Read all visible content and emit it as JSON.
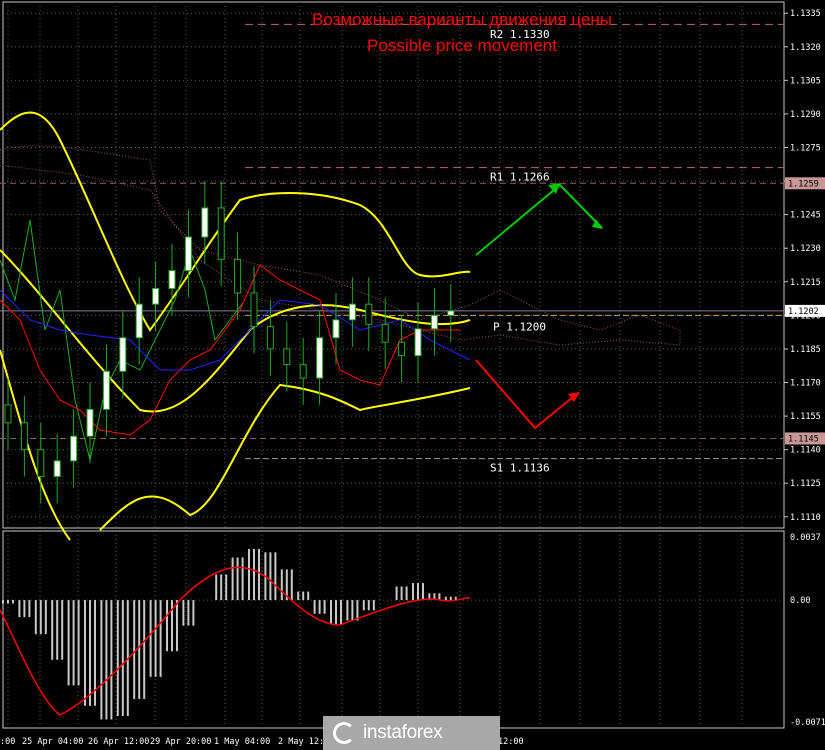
{
  "annotations": {
    "title_ru": "Возможные варианты движения цены",
    "title_en": "Possible price movement",
    "r2": "R2 1.1330",
    "r1": "R1 1.1266",
    "pivot": "P 1.1200",
    "s1": "S1 1.1136"
  },
  "price_axis": {
    "ticks": [
      "1.1335",
      "1.1320",
      "1.1305",
      "1.1290",
      "1.1275",
      "1.1260",
      "1.1245",
      "1.1230",
      "1.1215",
      "1.1200",
      "1.1185",
      "1.1170",
      "1.1155",
      "1.1140",
      "1.1125",
      "1.1110"
    ],
    "tag_upper": "1.1259",
    "tag_current": "1.1202",
    "tag_lower": "1.1145"
  },
  "osc_axis": {
    "ticks": [
      "0.0037",
      "0.00",
      "-0.00715"
    ]
  },
  "time_axis": {
    "labels": [
      ":00",
      "25 Apr 04:00",
      "26 Apr 12:00",
      "29 Apr 20:00",
      "1 May 04:00",
      "2 May 12:00",
      "12:00"
    ]
  },
  "watermark": {
    "brand": "instaforex"
  },
  "colors": {
    "background": "#000000",
    "grid": "#5a5a5a",
    "candle_bull": "#ffffff",
    "bollinger": "#ffff00",
    "fast_line": "#22aa22",
    "red_line": "#ff0000",
    "blue_line": "#2222ff",
    "arrow_up": "#00cc00",
    "arrow_down": "#ff0000",
    "title": "#ff0000"
  },
  "chart_data": {
    "type": "line",
    "price_range": [
      1.1105,
      1.134
    ],
    "osc_range": [
      -0.00715,
      0.0037
    ],
    "candles_close": [
      1.1152,
      1.114,
      1.1128,
      1.1135,
      1.1146,
      1.1158,
      1.1175,
      1.119,
      1.1205,
      1.1212,
      1.122,
      1.1235,
      1.1248,
      1.1225,
      1.121,
      1.1195,
      1.1185,
      1.1178,
      1.1172,
      1.119,
      1.1198,
      1.1205,
      1.1196,
      1.1188,
      1.1182,
      1.1194,
      1.12,
      1.1202
    ],
    "osc_histogram": [
      -0.0002,
      -0.001,
      -0.002,
      -0.0035,
      -0.005,
      -0.0062,
      -0.007,
      -0.0068,
      -0.0058,
      -0.0045,
      -0.003,
      -0.0015,
      0.0,
      0.0015,
      0.0025,
      0.003,
      0.0028,
      0.0018,
      0.0005,
      -0.0008,
      -0.0014,
      -0.0012,
      -0.0006,
      0.0,
      0.0008,
      0.001,
      0.0004,
      0.0002
    ]
  }
}
